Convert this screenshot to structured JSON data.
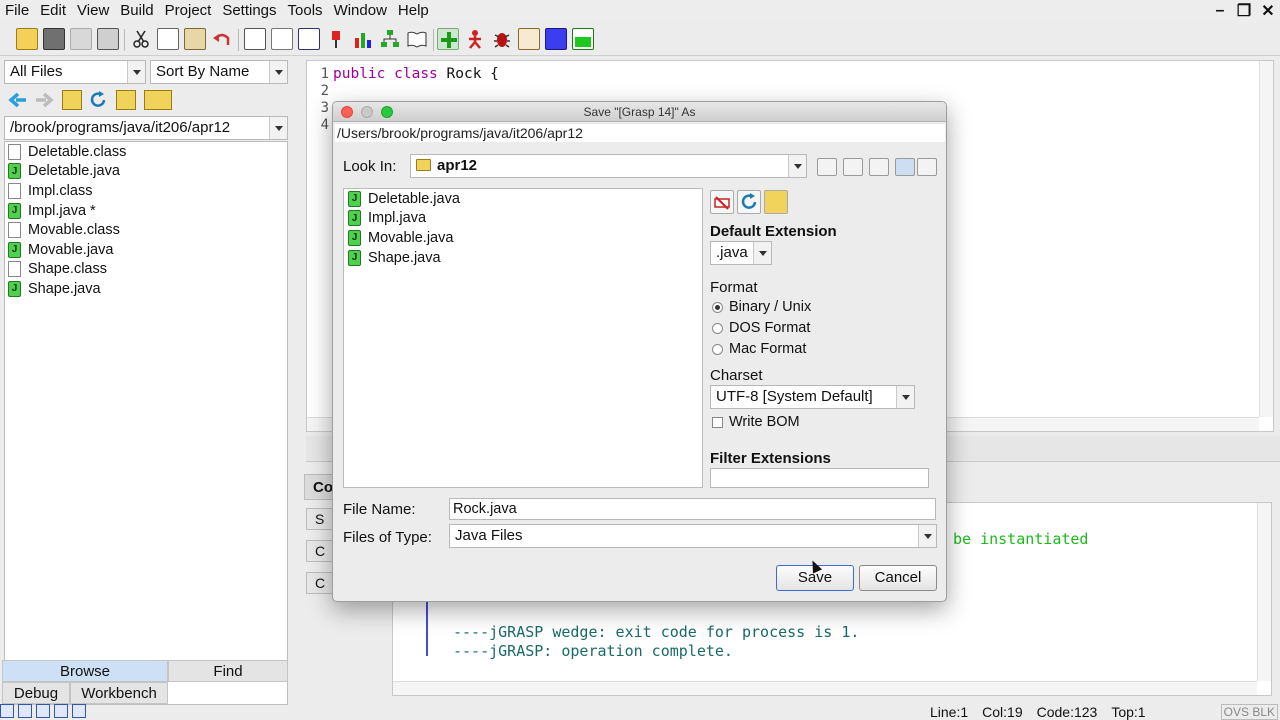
{
  "menu": [
    "File",
    "Edit",
    "View",
    "Build",
    "Project",
    "Settings",
    "Tools",
    "Window",
    "Help"
  ],
  "left_panel": {
    "filter": "All Files",
    "sort": "Sort By Name",
    "path": "/brook/programs/java/it206/apr12",
    "files": [
      {
        "name": "Deletable.class",
        "kind": "class"
      },
      {
        "name": "Deletable.java",
        "kind": "java"
      },
      {
        "name": "Impl.class",
        "kind": "class"
      },
      {
        "name": "Impl.java *",
        "kind": "java"
      },
      {
        "name": "Movable.class",
        "kind": "class"
      },
      {
        "name": "Movable.java",
        "kind": "java"
      },
      {
        "name": "Shape.class",
        "kind": "class"
      },
      {
        "name": "Shape.java",
        "kind": "java"
      }
    ],
    "tabs_top": [
      "Browse",
      "Find"
    ],
    "tabs_bottom": [
      "Debug",
      "Workbench"
    ]
  },
  "editor": {
    "line_numbers": [
      "1",
      "2",
      "3",
      "4"
    ],
    "code_keyword1": "public",
    "code_keyword2": "class",
    "code_rest": " Rock {"
  },
  "console": {
    "tab_label": "Co",
    "left_buttons": [
      "S",
      "C",
      "C"
    ],
    "line_error_tail": "be instantiated",
    "line_exit": "----jGRASP wedge: exit code for process is 1.",
    "line_complete": "----jGRASP: operation complete."
  },
  "status_bar": {
    "line": "Line:1",
    "col": "Col:19",
    "code": "Code:123",
    "top": "Top:1",
    "mode": "OVS BLK"
  },
  "dialog": {
    "title": "Save \"[Grasp 14]\" As",
    "path": "/Users/brook/programs/java/it206/apr12",
    "look_in_label": "Look In:",
    "look_in_value": "apr12",
    "files": [
      "Deletable.java",
      "Impl.java",
      "Movable.java",
      "Shape.java"
    ],
    "default_ext_label": "Default Extension",
    "default_ext_value": ".java",
    "format_label": "Format",
    "format_options": [
      "Binary / Unix",
      "DOS Format",
      "Mac Format"
    ],
    "format_selected": 0,
    "charset_label": "Charset",
    "charset_value": "UTF-8 [System Default]",
    "write_bom_label": "Write BOM",
    "filter_ext_label": "Filter Extensions",
    "filter_ext_value": "",
    "file_name_label": "File Name:",
    "file_name_value": "Rock.java",
    "files_of_type_label": "Files of Type:",
    "files_of_type_value": "Java Files",
    "save_label": "Save",
    "cancel_label": "Cancel"
  }
}
